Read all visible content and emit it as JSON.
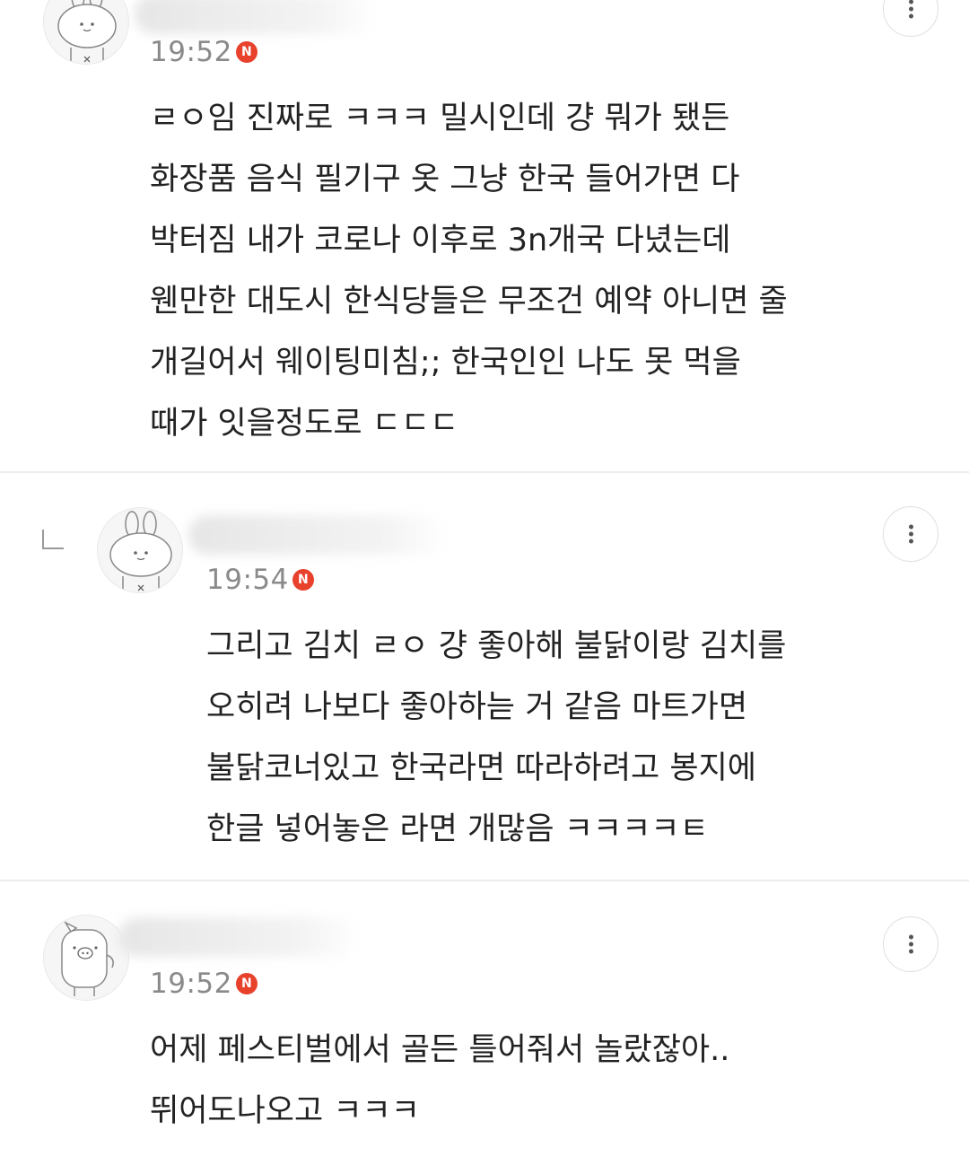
{
  "comments": [
    {
      "avatar": "rabbit-character-avatar",
      "time": "19:52",
      "badge": "N",
      "lines": [
        "ㄹㅇ임 진짜로 ㅋㅋㅋ 밀시인데 걍 뭐가 됐든",
        "화장품 음식 필기구 옷 그냥 한국 들어가면 다",
        "박터짐 내가 코로나 이후로 3n개국 다녔는데",
        "웬만한 대도시 한식당들은 무조건 예약 아니면 줄",
        "개길어서 웨이팅미침;; 한국인인 나도 못 먹을",
        "때가 잇을정도로 ㄷㄷㄷ"
      ]
    },
    {
      "avatar": "rabbit-character-avatar",
      "is_reply": true,
      "time": "19:54",
      "badge": "N",
      "lines": [
        "그리고 김치 ㄹㅇ 걍 좋아해 불닭이랑 김치를",
        "오히려 나보다 좋아하늗 거 같음 마트가면",
        "불닭코너있고 한국라면 따라하려고 봉지에",
        "한글 넣어놓은 라면 개많음 ㅋㅋㅋㅋㅌ"
      ]
    },
    {
      "avatar": "pig-character-avatar",
      "time": "19:52",
      "badge": "N",
      "lines": [
        "어제 페스티벌에서 골든 틀어줘서 놀랐잖아..",
        "뛰어도나오고 ㅋㅋㅋ"
      ]
    }
  ],
  "colors": {
    "badge": "#e8412c",
    "timestamp": "#8a8a8a",
    "text": "#222222",
    "divider": "#ededed"
  },
  "icons": {
    "more": "more-vertical-icon",
    "reply": "reply-indent-icon",
    "new": "new-badge-icon"
  }
}
